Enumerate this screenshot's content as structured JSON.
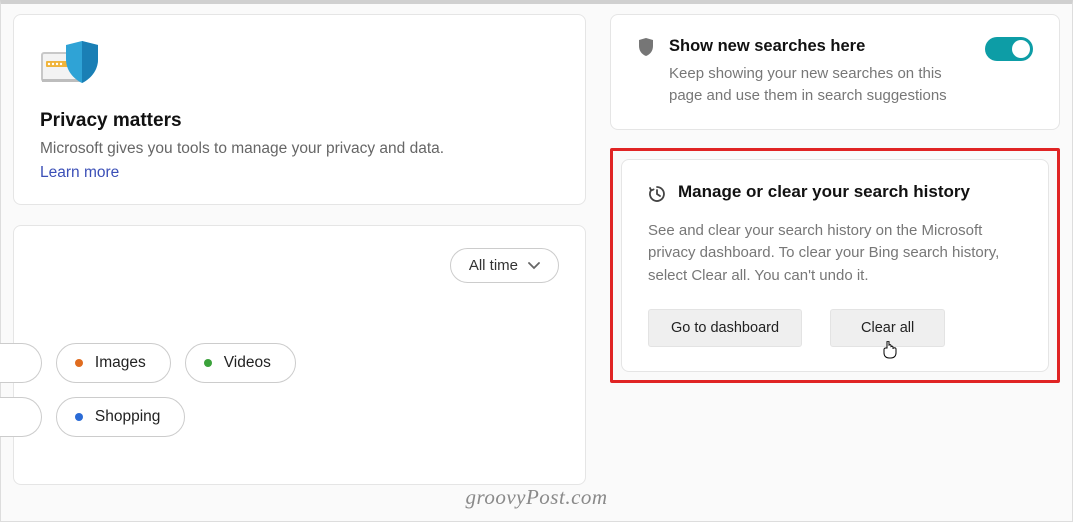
{
  "privacy": {
    "title": "Privacy matters",
    "desc": "Microsoft gives you tools to manage your privacy and data.",
    "learn_more": "Learn more"
  },
  "filter": {
    "dropdown_label": "All time",
    "chips": {
      "images": "Images",
      "videos": "Videos",
      "shopping": "Shopping"
    }
  },
  "show_searches": {
    "title": "Show new searches here",
    "desc": "Keep showing your new searches on this page and use them in search suggestions"
  },
  "manage": {
    "title": "Manage or clear your search history",
    "desc": "See and clear your search history on the Microsoft privacy dashboard. To clear your Bing search history, select Clear all. You can't undo it.",
    "dashboard_btn": "Go to dashboard",
    "clear_btn": "Clear all"
  },
  "watermark": "groovyPost.com"
}
